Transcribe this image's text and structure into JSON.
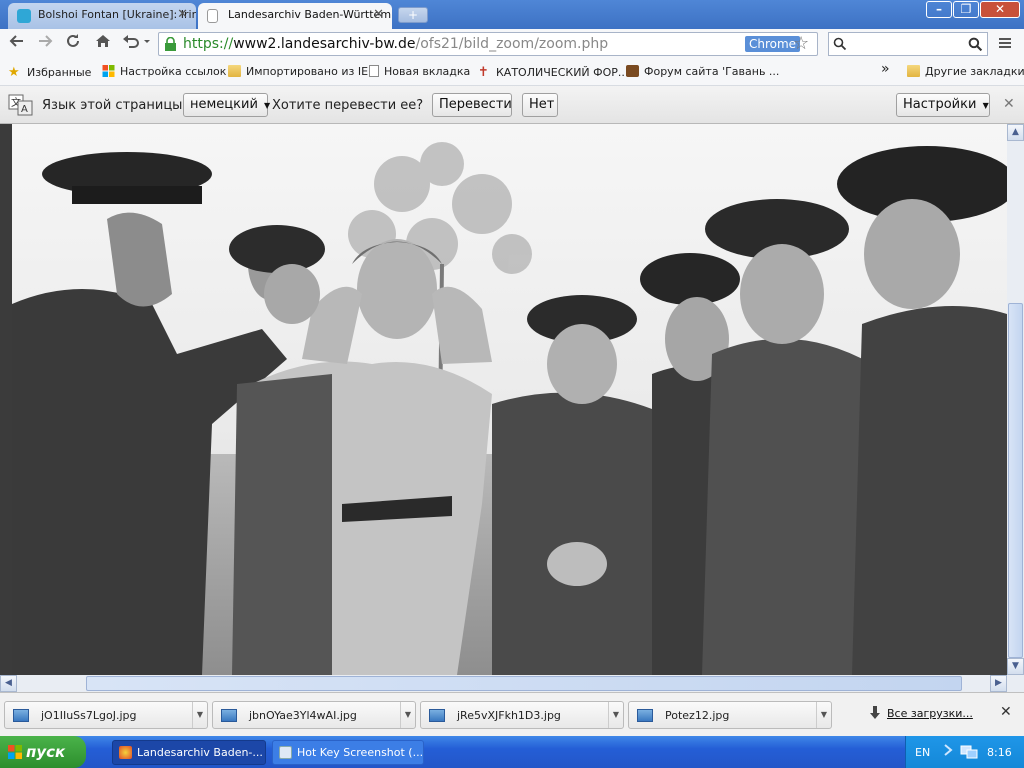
{
  "colors": {
    "tab_strip": "#4f86d6",
    "url_scheme": "#2a8a2a",
    "taskbar": "#245ed6",
    "start_button": "#3ba03b"
  },
  "tabs": [
    {
      "title": "Bolshoi Fontan [Ukraine]: Irin",
      "icon": "site-favicon-icon",
      "active": false
    },
    {
      "title": "Landesarchiv Baden-Württem",
      "icon": "page-icon",
      "active": true
    }
  ],
  "window_controls": {
    "minimize": "–",
    "maximize": "❐",
    "close": "✕"
  },
  "address": {
    "scheme": "https://",
    "host": "www2.landesarchiv-bw.de",
    "path": "/ofs21/bild_zoom/zoom.php",
    "badge": "Chrome"
  },
  "bookmarks": [
    {
      "label": "Избранные",
      "icon": "star-icon"
    },
    {
      "label": "Настройка ссылок",
      "icon": "windows-icon"
    },
    {
      "label": "Импортировано из IE",
      "icon": "folder-icon"
    },
    {
      "label": "Новая вкладка",
      "icon": "page-icon"
    },
    {
      "label": "КАТОЛИЧЕСКИЙ ФОР...",
      "icon": "cross-icon"
    },
    {
      "label": "Форум сайта 'Гавань ...",
      "icon": "forum-icon"
    }
  ],
  "bookmarks_overflow": "»",
  "other_bookmarks": "Другие закладки",
  "translate_bar": {
    "prompt": "Язык этой страницы",
    "language": "немецкий",
    "question": "Хотите перевести ее?",
    "translate_button": "Перевести",
    "no_button": "Нет",
    "settings_button": "Настройки",
    "close": "✕"
  },
  "photo": {
    "description_icon": "archive-photo"
  },
  "downloads": [
    {
      "file": "jO1IIuSs7LgoJ.jpg"
    },
    {
      "file": "jbnOYae3Yl4wAI.jpg"
    },
    {
      "file": "jRe5vXJFkh1D3.jpg"
    },
    {
      "file": "Potez12.jpg"
    }
  ],
  "all_downloads": "Все загрузки...",
  "taskbar": {
    "start": "пуск",
    "tasks": [
      {
        "label": "Landesarchiv Baden-...",
        "active": true
      },
      {
        "label": "Hot Key Screenshot (...",
        "active": false
      }
    ],
    "lang": "EN",
    "clock": "8:16"
  }
}
